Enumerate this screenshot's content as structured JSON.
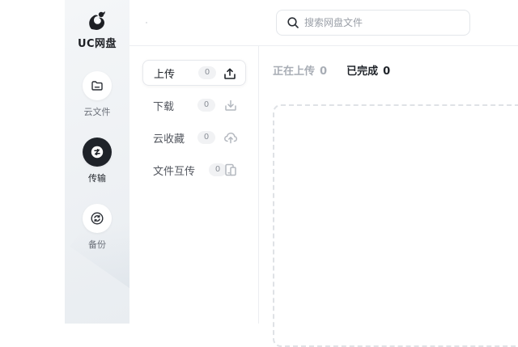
{
  "app": {
    "logo_text": "UC网盘"
  },
  "nav": [
    {
      "label": "云文件",
      "icon": "folder-icon",
      "active": false
    },
    {
      "label": "传输",
      "icon": "transfer-icon",
      "active": true
    },
    {
      "label": "备份",
      "icon": "sync-icon",
      "active": false
    }
  ],
  "search": {
    "placeholder": "搜索网盘文件",
    "value": ""
  },
  "transfer_list": [
    {
      "label": "上传",
      "count": "0",
      "icon": "upload-icon",
      "active": true
    },
    {
      "label": "下载",
      "count": "0",
      "icon": "download-icon",
      "active": false
    },
    {
      "label": "云收藏",
      "count": "0",
      "icon": "cloud-upload-icon",
      "active": false
    },
    {
      "label": "文件互传",
      "count": "0",
      "icon": "device-transfer-icon",
      "active": false
    }
  ],
  "tabs": [
    {
      "label": "正在上传",
      "count": "0",
      "active": false
    },
    {
      "label": "已完成",
      "count": "0",
      "active": true
    }
  ],
  "colors": {
    "rail_bg": "#eef1f4",
    "active_dark": "#1f2329",
    "muted": "#a8adb5"
  }
}
